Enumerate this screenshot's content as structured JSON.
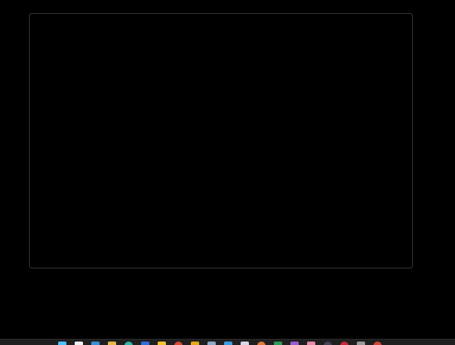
{
  "window": {
    "title": ""
  },
  "taskbar": {
    "icons": [
      {
        "name": "start-icon",
        "color": "#4cc2ff"
      },
      {
        "name": "file-icon",
        "color": "#f0f0f0"
      },
      {
        "name": "mail-icon",
        "color": "#3b8fd9"
      },
      {
        "name": "folder-icon",
        "color": "#e8b84a"
      },
      {
        "name": "edge-browser-icon",
        "color": "#2fb7a8"
      },
      {
        "name": "app-blue-icon",
        "color": "#2f6fd8"
      },
      {
        "name": "drive-icon",
        "color": "#f2c230"
      },
      {
        "name": "chrome-icon",
        "color": "#d94a38"
      },
      {
        "name": "app-yellow-icon",
        "color": "#e6a817"
      },
      {
        "name": "document-icon",
        "color": "#8fa8c8"
      },
      {
        "name": "app-lightblue-icon",
        "color": "#3d9be0"
      },
      {
        "name": "notepad-icon",
        "color": "#d8d8e8"
      },
      {
        "name": "app-orange-icon",
        "color": "#e07a3c"
      },
      {
        "name": "spreadsheet-icon",
        "color": "#2e9a5a"
      },
      {
        "name": "app-purple-icon",
        "color": "#9a5bd0"
      },
      {
        "name": "app-pink-icon",
        "color": "#e58aa8"
      },
      {
        "name": "app-dark-icon",
        "color": "#444455"
      },
      {
        "name": "app-red-icon",
        "color": "#c8283a"
      },
      {
        "name": "settings-gear-icon",
        "color": "#9a9a9a"
      },
      {
        "name": "app-redround-icon",
        "color": "#d0453c"
      }
    ]
  }
}
